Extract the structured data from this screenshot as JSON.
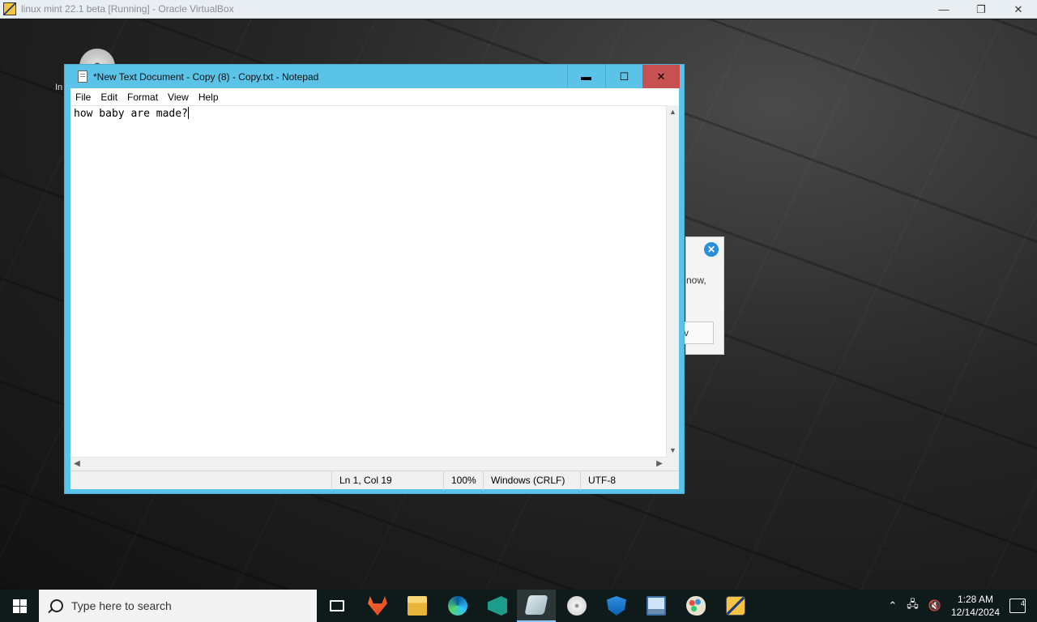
{
  "host_window": {
    "title": "linux mint 22.1 beta [Running] - Oracle VirtualBox",
    "controls": {
      "minimize": "—",
      "restore": "❐",
      "close": "✕"
    }
  },
  "desktop": {
    "icon_label": "In"
  },
  "background_dialog": {
    "close_glyph": "✕",
    "text_snippet": "now,",
    "button_label": "v"
  },
  "notepad": {
    "title": "*New Text Document - Copy (8) - Copy.txt - Notepad",
    "controls": {
      "minimize": "▬",
      "maximize": "☐",
      "close": "✕"
    },
    "menu": [
      "File",
      "Edit",
      "Format",
      "View",
      "Help"
    ],
    "content": "how baby are made?",
    "statusbar": {
      "position": "Ln 1, Col 19",
      "zoom": "100%",
      "line_ending": "Windows (CRLF)",
      "encoding": "UTF-8"
    }
  },
  "taskbar": {
    "search_placeholder": "Type here to search",
    "pinned": [
      "task-view-icon",
      "gitlab-icon",
      "file-explorer-icon",
      "edge-icon",
      "visual-studio-icon",
      "virtualbox-vm-icon",
      "disc-icon",
      "windows-security-icon",
      "remote-desktop-icon",
      "paint-icon",
      "virtualbox-icon"
    ],
    "clock_time": "1:28 AM",
    "clock_date": "12/14/2024",
    "notification_count": "4"
  }
}
